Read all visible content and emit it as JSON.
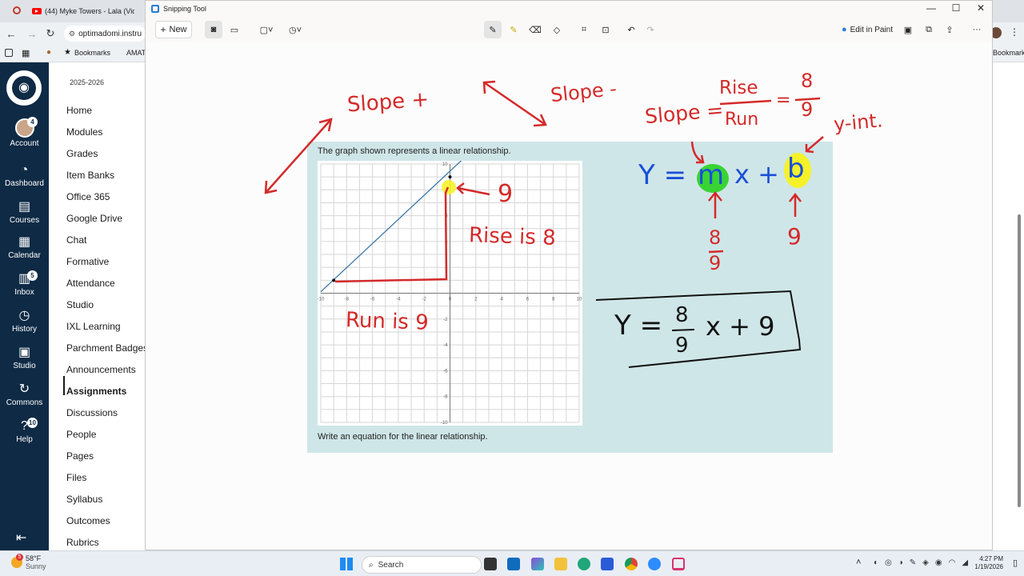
{
  "browser": {
    "tab_title": "(44) Myke Towers - Lala (Video",
    "address": "optimadomi.instru",
    "bookmarks_label": "Bookmarks",
    "bookmark2_label": "AMAT",
    "bookmarks_right_label": "Bookmarks"
  },
  "canvas_global_nav": {
    "items": [
      {
        "label": "Account",
        "badge": "4"
      },
      {
        "label": "Dashboard",
        "badge": ""
      },
      {
        "label": "Courses",
        "badge": ""
      },
      {
        "label": "Calendar",
        "badge": ""
      },
      {
        "label": "Inbox",
        "badge": "5"
      },
      {
        "label": "History",
        "badge": ""
      },
      {
        "label": "Studio",
        "badge": ""
      },
      {
        "label": "Commons",
        "badge": ""
      },
      {
        "label": "Help",
        "badge": "10"
      }
    ]
  },
  "course_nav": {
    "term": "2025-2026",
    "items": [
      "Home",
      "Modules",
      "Grades",
      "Item Banks",
      "Office 365",
      "Google Drive",
      "Chat",
      "Formative",
      "Attendance",
      "Studio",
      "IXL Learning",
      "Parchment Badges",
      "Announcements",
      "Assignments",
      "Discussions",
      "People",
      "Pages",
      "Files",
      "Syllabus",
      "Outcomes",
      "Rubrics"
    ],
    "active": "Assignments"
  },
  "snipping_tool": {
    "title": "Snipping Tool",
    "new_label": "New",
    "edit_in_paint_label": "Edit in Paint",
    "more_label": "···"
  },
  "question": {
    "prompt": "The graph shown represents a linear relationship.",
    "task": "Write an equation for the linear relationship."
  },
  "graph": {
    "x_ticks": [
      "-10",
      "-8",
      "-6",
      "-4",
      "-2",
      "0",
      "2",
      "4",
      "6",
      "8",
      "10"
    ],
    "y_ticks": [
      "10",
      "8",
      "6",
      "4",
      "2",
      "-2",
      "-4",
      "-6",
      "-8",
      "-10"
    ],
    "x_range": [
      -10,
      10
    ],
    "y_range": [
      -10,
      10
    ],
    "line_points": [
      [
        -9,
        1
      ],
      [
        0,
        9
      ]
    ]
  },
  "annotations": {
    "slope_pos": "Slope +",
    "slope_neg": "Slope -",
    "slope_eq_left": "Slope =",
    "rise_word": "Rise",
    "run_word": "Run",
    "eq_sign": "=",
    "frac_num": "8",
    "frac_den": "9",
    "y_int": "y-int.",
    "form_y": "Y =",
    "form_m": "m",
    "form_x_plus": "x +",
    "form_b": "b",
    "m_num": "8",
    "m_den": "9",
    "b_val": "9",
    "point_label": "9",
    "rise_label": "Rise is 8",
    "run_label": "Run is 9",
    "final_y": "Y =",
    "final_num": "8",
    "final_den": "9",
    "final_rest": "x + 9"
  },
  "taskbar": {
    "temperature": "58°F",
    "condition": "Sunny",
    "weather_badge": "5",
    "search_placeholder": "Search",
    "time": "4:27 PM",
    "date": "1/19/2026"
  },
  "colors": {
    "canvas_nav": "#0e2a45",
    "card": "#cfe6e8",
    "ink_red": "#d42a2a",
    "ink_blue": "#1a4fd6",
    "highlight_green": "#39d434",
    "highlight_yellow": "#f5f22a"
  }
}
